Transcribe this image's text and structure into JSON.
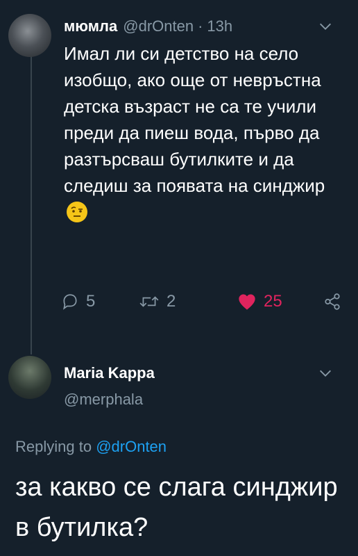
{
  "tweet": {
    "author_name": "мюмла",
    "author_handle": "@drOnten",
    "separator": "·",
    "time": "13h",
    "text": "Имал ли си детство на село изобщо, ако още от невръстна детска възраст не са те учили преди да пиеш вода, първо да разтърсваш бутилките и да следиш за появата на синджир",
    "emoji_icon": "face-with-raised-eyebrow-icon",
    "replies": "5",
    "retweets": "2",
    "likes": "25"
  },
  "reply": {
    "author_name": "Maria Kappa",
    "author_handle": "@merphala",
    "replying_prefix": "Replying to",
    "replying_handle": "@drOnten",
    "text": "за какво се слага синджир в бутилка?"
  },
  "colors": {
    "background": "#15202b",
    "muted": "#8899a6",
    "link": "#1da1f2",
    "like": "#e0245e"
  }
}
